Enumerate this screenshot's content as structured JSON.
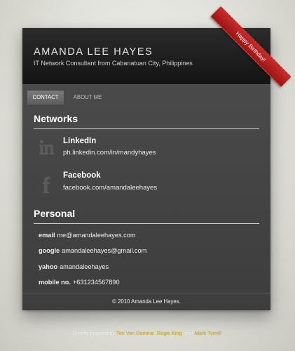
{
  "header": {
    "name": "AMANDA LEE HAYES",
    "tagline": "IT Network Consultant from Cabanatuan City, Philippines"
  },
  "ribbon": {
    "text": "Happy Birthday!",
    "color": "#b51d1d"
  },
  "tabs": [
    {
      "label": "CONTACT",
      "active": true
    },
    {
      "label": "ABOUT ME",
      "active": false
    }
  ],
  "networks": {
    "title": "Networks",
    "items": [
      {
        "name": "LinkedIn",
        "url": "ph.linkedin.com/in/mandyhayes",
        "icon": "linkedin-icon",
        "glyph": "in"
      },
      {
        "name": "Facebook",
        "url": "facebook.com/amandaleehayes",
        "icon": "facebook-icon",
        "glyph": "f"
      }
    ]
  },
  "personal": {
    "title": "Personal",
    "items": [
      {
        "label": "email",
        "value": "me@amandaleehayes.com"
      },
      {
        "label": "google",
        "value": "amandaleehayes@gmail.com"
      },
      {
        "label": "yahoo",
        "value": "amandaleehayes"
      },
      {
        "label": "mobile no.",
        "value": "+631234567890"
      }
    ]
  },
  "footer": {
    "copyright": "© 2010 Amanda Lee Hayes."
  },
  "credit": {
    "prefix": "Greatly inspired by ",
    "people": [
      "Tim Van Damme",
      "Rogie King",
      "Mark Tyrrell"
    ],
    "sep1": ", ",
    "sep2": ", and ",
    "suffix": "."
  }
}
